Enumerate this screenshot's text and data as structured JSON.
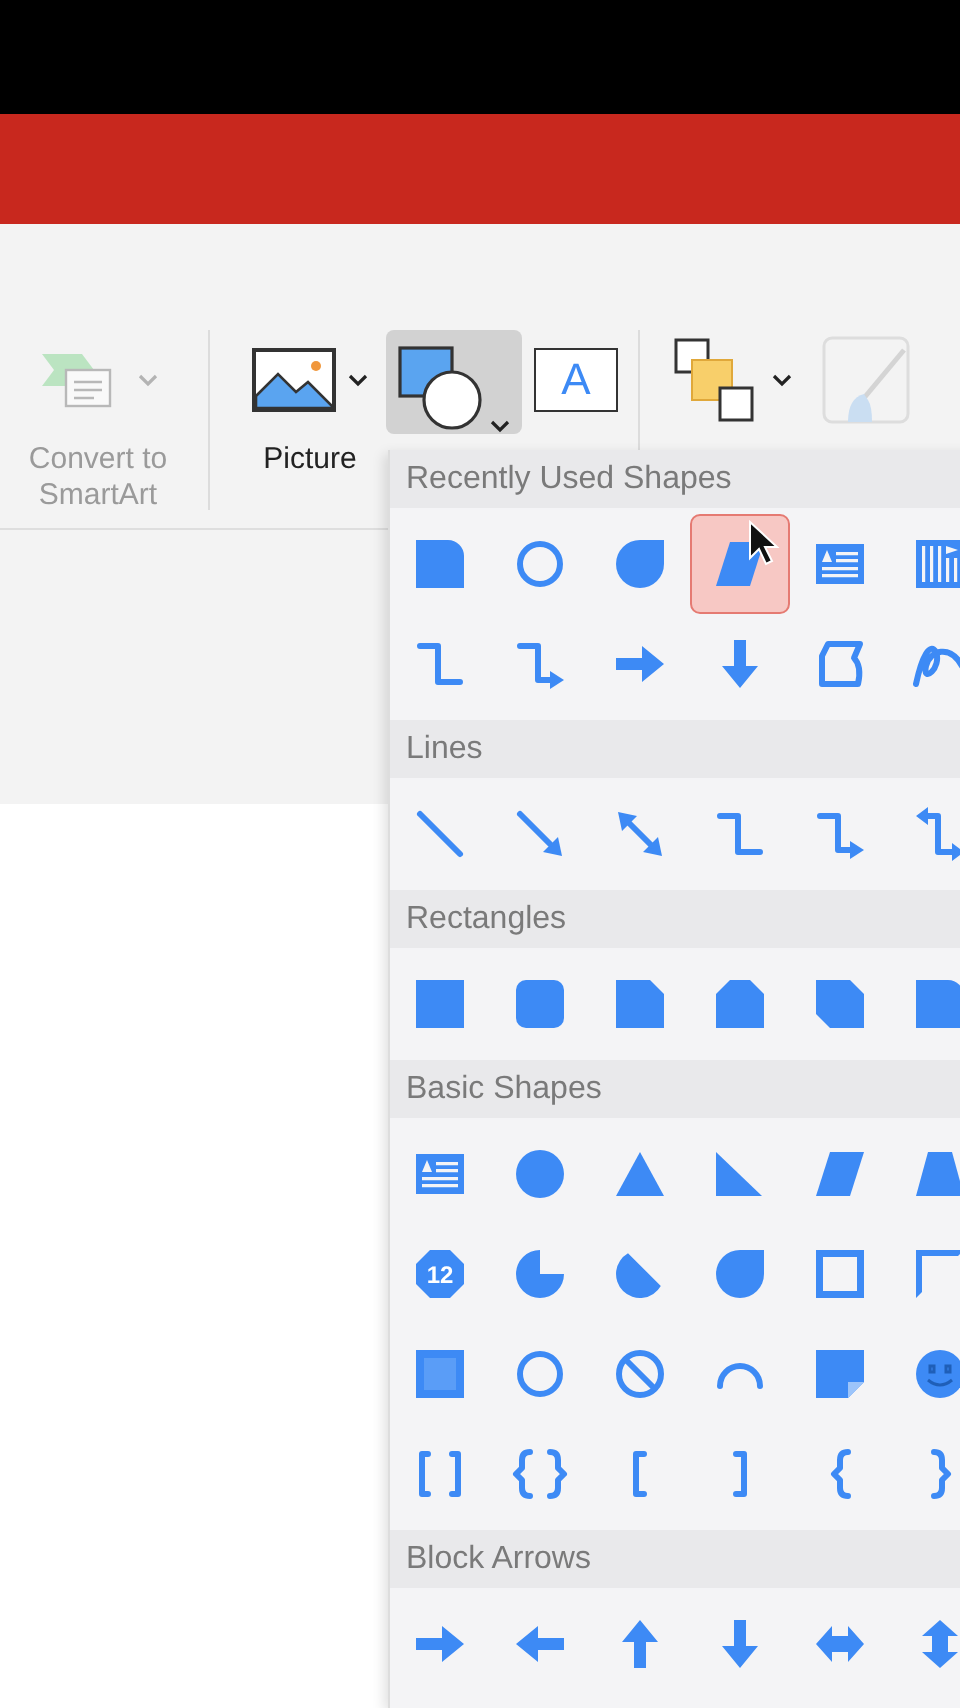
{
  "ribbon": {
    "items": [
      {
        "kind": "smartart",
        "label": "Convert to SmartArt",
        "dropdown": true,
        "disabled": true,
        "selected": false
      },
      {
        "kind": "picture",
        "label": "Picture",
        "dropdown": true,
        "disabled": false,
        "selected": false
      },
      {
        "kind": "shapes",
        "dropdown": true,
        "disabled": false,
        "selected": true
      },
      {
        "kind": "textbox",
        "label": "A",
        "dropdown": false,
        "disabled": false,
        "selected": false
      },
      {
        "kind": "arrange",
        "dropdown": true,
        "disabled": false,
        "selected": false
      },
      {
        "kind": "brush",
        "dropdown": false,
        "disabled": true,
        "selected": false
      }
    ]
  },
  "shapes_menu": {
    "sections": [
      {
        "title": "Recently Used Shapes",
        "items": [
          {
            "kind": "round-corner-rect",
            "selected": false
          },
          {
            "kind": "donut",
            "selected": false
          },
          {
            "kind": "teardrop",
            "selected": false
          },
          {
            "kind": "parallelogram",
            "selected": true
          },
          {
            "kind": "text-box",
            "selected": false
          },
          {
            "kind": "vertical-text",
            "selected": false
          },
          {
            "kind": "elbow-connector",
            "selected": false
          },
          {
            "kind": "elbow-arrow",
            "selected": false
          },
          {
            "kind": "right-arrow",
            "selected": false
          },
          {
            "kind": "down-arrow",
            "selected": false
          },
          {
            "kind": "freeform",
            "selected": false
          },
          {
            "kind": "scribble",
            "selected": false
          }
        ]
      },
      {
        "title": "Lines",
        "items": [
          {
            "kind": "line",
            "selected": false
          },
          {
            "kind": "line-arrow",
            "selected": false
          },
          {
            "kind": "double-arrow-line",
            "selected": false
          },
          {
            "kind": "elbow-connector",
            "selected": false
          },
          {
            "kind": "elbow-arrow",
            "selected": false
          },
          {
            "kind": "elbow-double-arrow",
            "selected": false
          }
        ]
      },
      {
        "title": "Rectangles",
        "items": [
          {
            "kind": "rect",
            "selected": false
          },
          {
            "kind": "rounded-rect",
            "selected": false
          },
          {
            "kind": "snip-corner-rect",
            "selected": false
          },
          {
            "kind": "snip-same-side",
            "selected": false
          },
          {
            "kind": "snip-diagonal",
            "selected": false
          },
          {
            "kind": "round-corner-rect",
            "selected": false
          }
        ]
      },
      {
        "title": "Basic Shapes",
        "items": [
          {
            "kind": "text-box",
            "selected": false
          },
          {
            "kind": "oval",
            "selected": false
          },
          {
            "kind": "triangle",
            "selected": false
          },
          {
            "kind": "right-triangle",
            "selected": false
          },
          {
            "kind": "parallelogram",
            "selected": false
          },
          {
            "kind": "trapezoid",
            "selected": false
          },
          {
            "kind": "octagon",
            "label": "12",
            "selected": false
          },
          {
            "kind": "pie",
            "selected": false
          },
          {
            "kind": "chord",
            "selected": false
          },
          {
            "kind": "teardrop",
            "selected": false
          },
          {
            "kind": "frame",
            "selected": false
          },
          {
            "kind": "half-frame",
            "selected": false
          },
          {
            "kind": "bevel",
            "selected": false
          },
          {
            "kind": "donut",
            "selected": false
          },
          {
            "kind": "no-symbol",
            "selected": false
          },
          {
            "kind": "block-arc",
            "selected": false
          },
          {
            "kind": "folded-corner",
            "selected": false
          },
          {
            "kind": "smiley",
            "selected": false
          },
          {
            "kind": "double-bracket",
            "selected": false
          },
          {
            "kind": "double-brace",
            "selected": false
          },
          {
            "kind": "left-bracket",
            "selected": false
          },
          {
            "kind": "right-bracket",
            "selected": false
          },
          {
            "kind": "left-brace",
            "selected": false
          },
          {
            "kind": "right-brace",
            "selected": false
          }
        ]
      },
      {
        "title": "Block Arrows",
        "items": [
          {
            "kind": "right-arrow",
            "selected": false
          },
          {
            "kind": "left-arrow",
            "selected": false
          },
          {
            "kind": "up-arrow",
            "selected": false
          },
          {
            "kind": "down-arrow",
            "selected": false
          },
          {
            "kind": "left-right-arrow",
            "selected": false
          },
          {
            "kind": "up-down-arrow",
            "selected": false
          }
        ]
      }
    ]
  }
}
